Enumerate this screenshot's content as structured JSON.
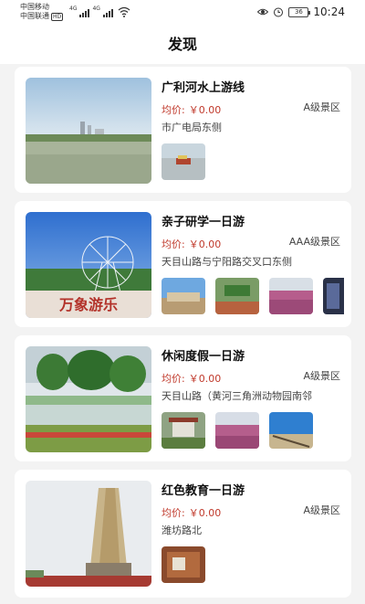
{
  "status_bar": {
    "carrier1": "中国移动",
    "carrier2": "中国联通",
    "hd_badge": "HD",
    "net1": "4G",
    "net2": "4G",
    "battery": "36",
    "time": "10:24",
    "icons": [
      "signal-icon",
      "wifi-icon",
      "eye-icon",
      "alarm-icon",
      "battery-icon"
    ]
  },
  "header": {
    "title": "发现"
  },
  "routes": [
    {
      "title": "广利河水上游线",
      "price_label": "均价:",
      "price": "￥0.00",
      "level": "A级景区",
      "address": "市广电局东侧"
    },
    {
      "title": "亲子研学一日游",
      "price_label": "均价:",
      "price": "￥0.00",
      "level": "AAA级景区",
      "address": "天目山路与宁阳路交叉口东侧",
      "banner_text": "万象游乐"
    },
    {
      "title": "休闲度假一日游",
      "price_label": "均价:",
      "price": "￥0.00",
      "level": "A级景区",
      "address": "天目山路（黄河三角洲动物园南邻"
    },
    {
      "title": "红色教育一日游",
      "price_label": "均价:",
      "price": "￥0.00",
      "level": "A级景区",
      "address": "潍坊路北"
    }
  ]
}
